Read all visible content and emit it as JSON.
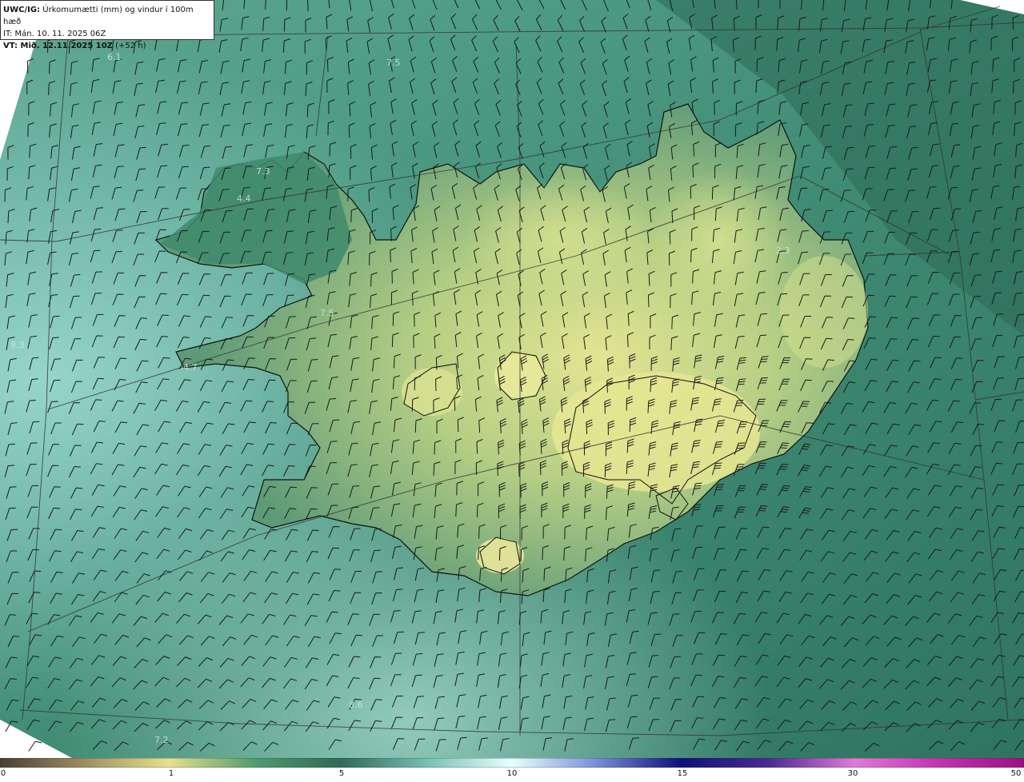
{
  "header": {
    "product": "UWC/IG:",
    "title": "Úrkomumætti (mm) og vindur í 100m hæð",
    "it_label": "IT:",
    "it_value": "Mán. 10. 11. 2025 06Z",
    "vt_label": "VT: Mið. 12.11.2025 10Z",
    "vt_offset": "(+52 h)"
  },
  "point_labels": [
    "6.1",
    "7.5",
    "7.3",
    "4.4",
    "2.3",
    "7.5",
    "9.3",
    "4.7",
    "8.6",
    "7.2"
  ],
  "colorbar": {
    "labels": [
      "0",
      "1",
      "5",
      "10",
      "15",
      "30",
      "50"
    ],
    "stops": [
      "#4a3f33",
      "#9c8b5f",
      "#e6e08e",
      "#3f8a6e",
      "#2e6a57",
      "#a8ecea",
      "#e8ffff",
      "#7a92d8",
      "#10107a",
      "#3a1a80",
      "#e07ad6",
      "#c020a8",
      "#9a1080"
    ]
  },
  "colors": {
    "sea_dark": "#2f6e58",
    "sea_light": "#8fd0c8",
    "land_high": "#cfdf8a",
    "coast": "#111111",
    "barb": "#1a1a1a"
  }
}
